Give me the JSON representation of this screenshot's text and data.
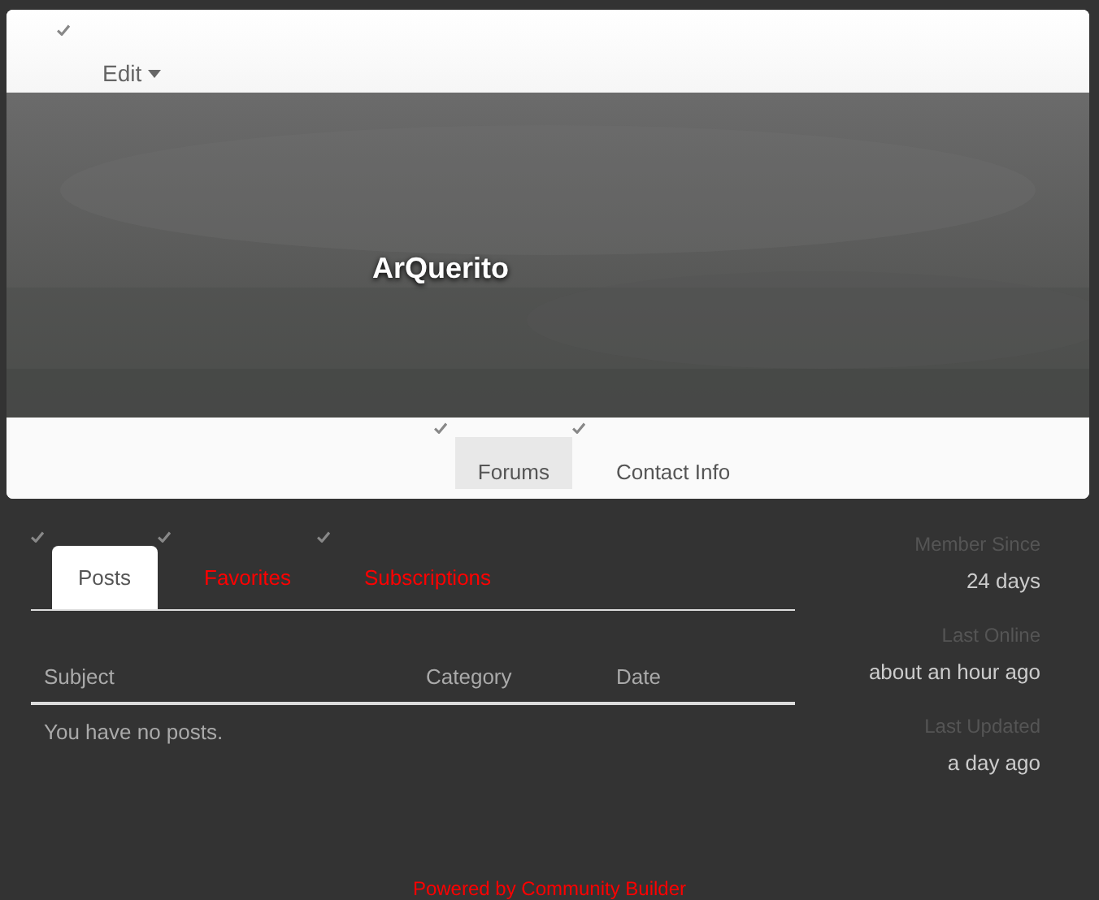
{
  "header": {
    "menu": {
      "label": "Edit"
    },
    "username": "ArQuerito",
    "tabs": [
      {
        "label": "Forums",
        "selected": true
      },
      {
        "label": "Contact Info",
        "selected": false
      }
    ]
  },
  "forum_tabs": [
    {
      "label": "Posts",
      "selected": true
    },
    {
      "label": "Favorites",
      "selected": false
    },
    {
      "label": "Subscriptions",
      "selected": false
    }
  ],
  "table": {
    "columns": [
      "Subject",
      "Category",
      "Date"
    ],
    "empty_message": "You have no posts."
  },
  "stats": [
    {
      "label": "Member Since",
      "value": "24 days"
    },
    {
      "label": "Last Online",
      "value": "about an hour ago"
    },
    {
      "label": "Last Updated",
      "value": "a day ago"
    }
  ],
  "footer": "Powered by Community Builder"
}
